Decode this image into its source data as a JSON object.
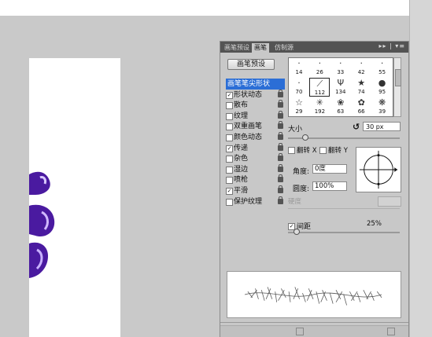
{
  "brush_panel": {
    "tabs": [
      {
        "label": "画笔预设",
        "active": false
      },
      {
        "label": "画笔",
        "active": true
      },
      {
        "label": "仿制源",
        "active": false
      }
    ],
    "menu_glyph": "▸▸ | ▾≡",
    "preset_button": "画笔预设",
    "options": [
      {
        "label": "画笔笔尖形状",
        "checked": null,
        "selected": true,
        "locked": false
      },
      {
        "label": "形状动态",
        "checked": true,
        "locked": true
      },
      {
        "label": "散布",
        "checked": false,
        "locked": true
      },
      {
        "label": "纹理",
        "checked": false,
        "locked": true
      },
      {
        "label": "双重画笔",
        "checked": false,
        "locked": true
      },
      {
        "label": "颜色动态",
        "checked": false,
        "locked": true
      },
      {
        "label": "传递",
        "checked": true,
        "locked": true
      },
      {
        "label": "杂色",
        "checked": false,
        "locked": true
      },
      {
        "label": "湿边",
        "checked": false,
        "locked": true
      },
      {
        "label": "喷枪",
        "checked": false,
        "locked": true
      },
      {
        "label": "平滑",
        "checked": true,
        "locked": true
      },
      {
        "label": "保护纹理",
        "checked": false,
        "locked": true
      }
    ],
    "brush_tips": [
      {
        "size": "14",
        "glyph": "·"
      },
      {
        "size": "26",
        "glyph": "·"
      },
      {
        "size": "33",
        "glyph": "·"
      },
      {
        "size": "42",
        "glyph": "·"
      },
      {
        "size": "55",
        "glyph": "·"
      },
      {
        "size": "70",
        "glyph": "·"
      },
      {
        "size": "112",
        "glyph": "⟋",
        "selected": true
      },
      {
        "size": "134",
        "glyph": "Ψ"
      },
      {
        "size": "74",
        "glyph": "★"
      },
      {
        "size": "95",
        "glyph": "●"
      },
      {
        "size": "29",
        "glyph": "☆"
      },
      {
        "size": "192",
        "glyph": "✳"
      },
      {
        "size": "63",
        "glyph": "❀"
      },
      {
        "size": "66",
        "glyph": "✿"
      },
      {
        "size": "39",
        "glyph": "❋"
      }
    ],
    "size": {
      "label": "大小",
      "value": "30 px",
      "reset_glyph": "↺"
    },
    "flip_x": {
      "label": "翻转 X",
      "checked": false
    },
    "flip_y": {
      "label": "翻转 Y",
      "checked": false
    },
    "angle": {
      "label": "角度:",
      "value": "0度"
    },
    "roundness": {
      "label": "圆度:",
      "value": "100%"
    },
    "hardness": {
      "label": "硬度",
      "enabled": false
    },
    "spacing": {
      "label": "间距",
      "checked": true,
      "value": "25%"
    },
    "size_slider_fraction": 0.13,
    "spacing_slider_fraction": 0.05
  },
  "colors": {
    "accent_selected": "#2b6ed6",
    "panel_bg": "#c8c8c8",
    "tab_bar_bg": "#535353",
    "artwork": "#4a1aa0"
  }
}
